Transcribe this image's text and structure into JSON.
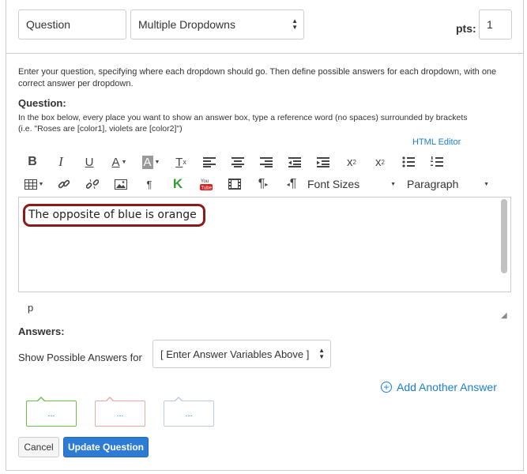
{
  "header": {
    "title_value": "Question",
    "type_value": "Multiple Dropdowns",
    "pts_label": "pts:",
    "pts_value": "1"
  },
  "intro_text": "Enter your question, specifying where each dropdown should go. Then define possible answers for each dropdown, with one correct answer per dropdown.",
  "question": {
    "label": "Question:",
    "help_line1": "In the box below, every place you want to show an answer box, type a reference word (no spaces) surrounded by brackets",
    "help_line2": "(i.e. \"Roses are [color1], violets are [color2]\")",
    "html_editor_link": "HTML Editor"
  },
  "toolbar": {
    "font_sizes": "Font Sizes",
    "paragraph": "Paragraph",
    "superscript_mark": "2",
    "subscript_mark": "2",
    "clear_mark": "x"
  },
  "editor": {
    "content": "The opposite of blue is orange",
    "path": "p"
  },
  "answers": {
    "label": "Answers:",
    "show_label": "Show Possible Answers for",
    "select_value": "[ Enter Answer Variables Above ]",
    "add_another": "Add Another Answer",
    "chip_text": "...",
    "chip_colors": [
      "#6cc04a",
      "#f3a6a6",
      "#b9c9e6"
    ]
  },
  "buttons": {
    "cancel": "Cancel",
    "update": "Update Question"
  },
  "colors": {
    "accent": "#2d7bd2",
    "link": "#1a7fd0",
    "highlight": "#8b1a1a"
  }
}
